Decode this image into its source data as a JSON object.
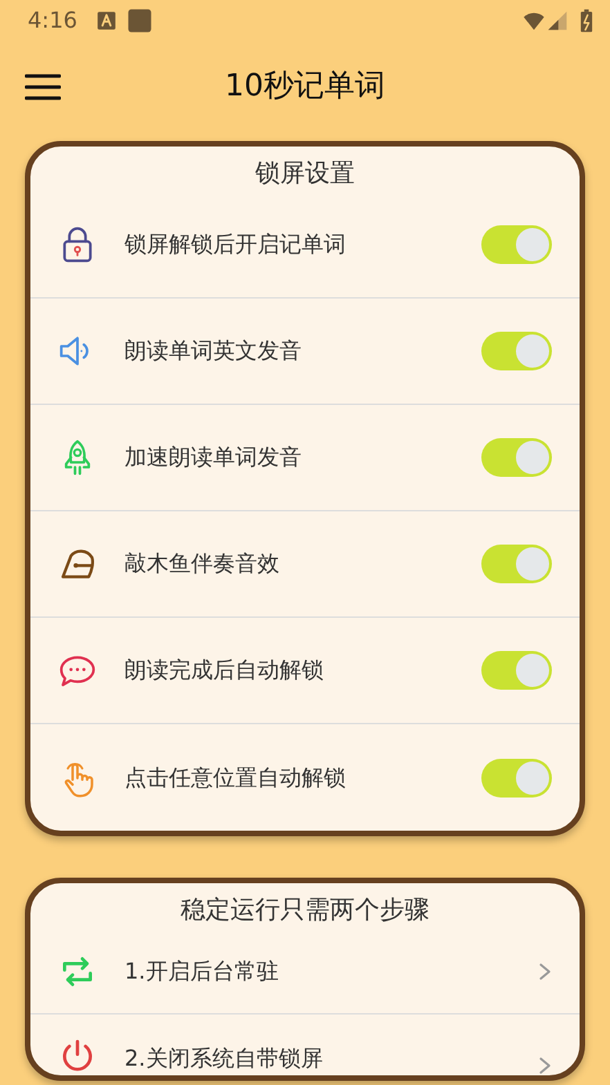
{
  "status_bar": {
    "time": "4:16"
  },
  "app_bar": {
    "title": "10秒记单词"
  },
  "lock_settings": {
    "title": "锁屏设置",
    "items": [
      {
        "label": "锁屏解锁后开启记单词",
        "on": true
      },
      {
        "label": "朗读单词英文发音",
        "on": true
      },
      {
        "label": "加速朗读单词发音",
        "on": true
      },
      {
        "label": "敲木鱼伴奏音效",
        "on": true
      },
      {
        "label": "朗读完成后自动解锁",
        "on": true
      },
      {
        "label": "点击任意位置自动解锁",
        "on": true
      }
    ]
  },
  "steps": {
    "title": "稳定运行只需两个步骤",
    "items": [
      {
        "label": "1.开启后台常驻"
      },
      {
        "label": "2.关闭系统自带锁屏"
      }
    ]
  }
}
